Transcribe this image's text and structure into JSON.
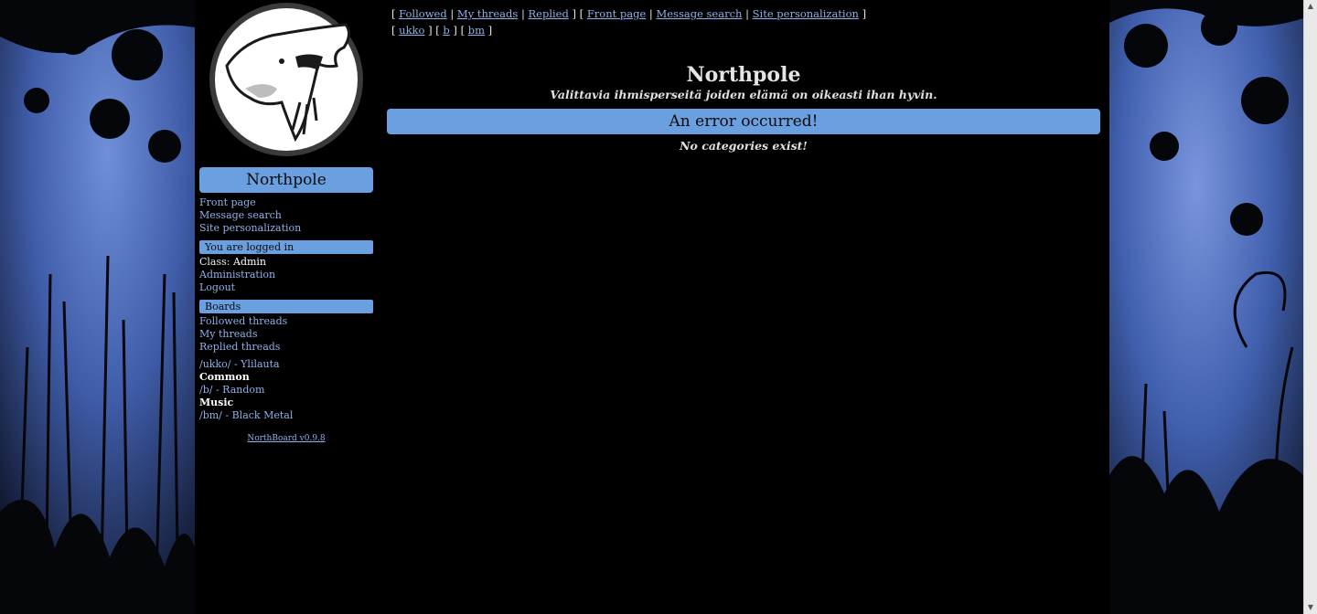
{
  "topnav": {
    "line1": [
      "Followed",
      "My threads",
      "Replied",
      "Front page",
      "Message search",
      "Site personalization"
    ],
    "line2": [
      "ukko",
      "b",
      "bm"
    ]
  },
  "sidebar": {
    "site_title": "Northpole",
    "menu": [
      "Front page",
      "Message search",
      "Site personalization"
    ],
    "login_section": "You are logged in",
    "class_label": "Class:",
    "class_value": "Admin",
    "admin_links": [
      "Administration",
      "Logout"
    ],
    "boards_section": "Boards",
    "thread_links": [
      "Followed threads",
      "My threads",
      "Replied threads"
    ],
    "boards": [
      {
        "label": "/ukko/ - Ylilauta"
      },
      {
        "category": "Common"
      },
      {
        "label": "/b/ - Random"
      },
      {
        "category": "Music"
      },
      {
        "label": "/bm/ - Black Metal"
      }
    ],
    "footer": "NorthBoard v0.9.8"
  },
  "main": {
    "title": "Northpole",
    "subtitle": "Valittavia ihmisperseitä joiden elämä on oikeasti ihan hyvin.",
    "error_title": "An error occurred!",
    "error_message": "No categories exist!"
  },
  "colors": {
    "accent": "#6a9fe0",
    "link": "#8fb0e8",
    "background": "#000000"
  },
  "icons": [
    "howling-bear-logo",
    "scroll-up-arrow-icon",
    "scroll-down-arrow-icon"
  ]
}
